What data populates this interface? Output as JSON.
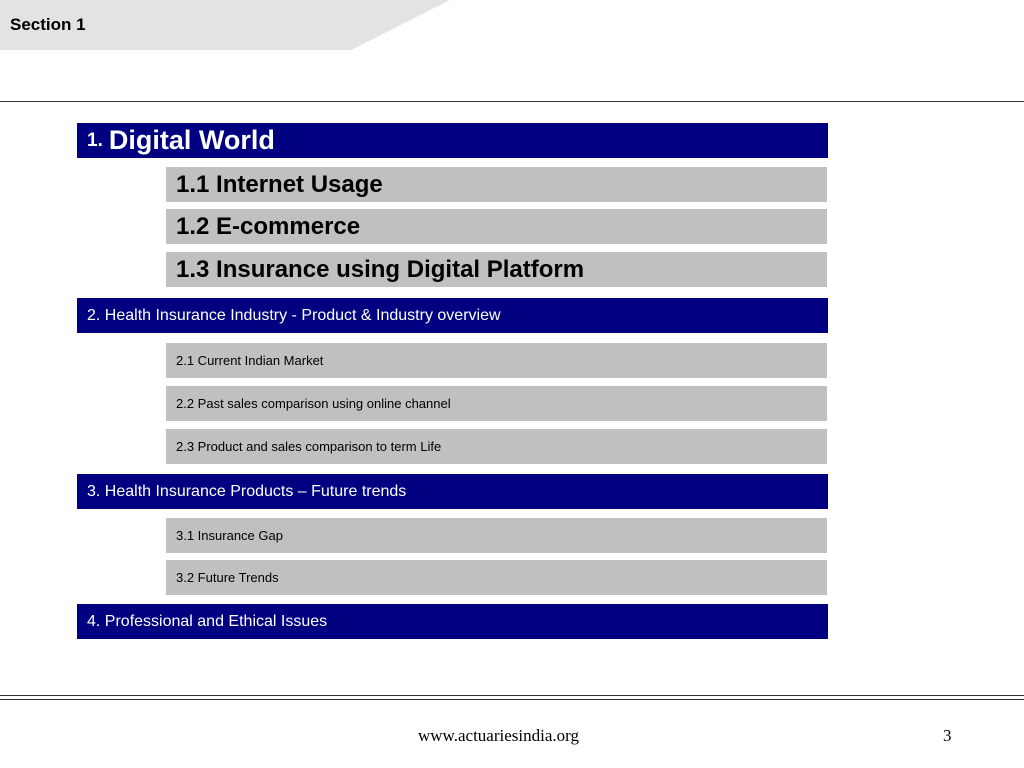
{
  "header": {
    "section_label": "Section 1"
  },
  "agenda": {
    "s1": {
      "number": "1.",
      "title": "Digital World",
      "items": [
        "1.1 Internet Usage",
        "1.2 E-commerce",
        "1.3 Insurance using Digital Platform"
      ]
    },
    "s2": {
      "title": "2. Health Insurance Industry - Product & Industry overview",
      "items": [
        "2.1 Current Indian Market",
        "2.2 Past sales comparison using online channel",
        "2.3 Product and sales comparison to term Life"
      ]
    },
    "s3": {
      "title": "3. Health Insurance Products – Future trends",
      "items": [
        "3.1 Insurance Gap",
        "3.2 Future Trends"
      ]
    },
    "s4": {
      "title": "4. Professional and Ethical Issues"
    }
  },
  "footer": {
    "url": "www.actuariesindia.org",
    "page_number": "3"
  },
  "colors": {
    "section_bar": "#000080",
    "sub_bar": "#c0c0c0",
    "tab": "#e3e3e3"
  }
}
